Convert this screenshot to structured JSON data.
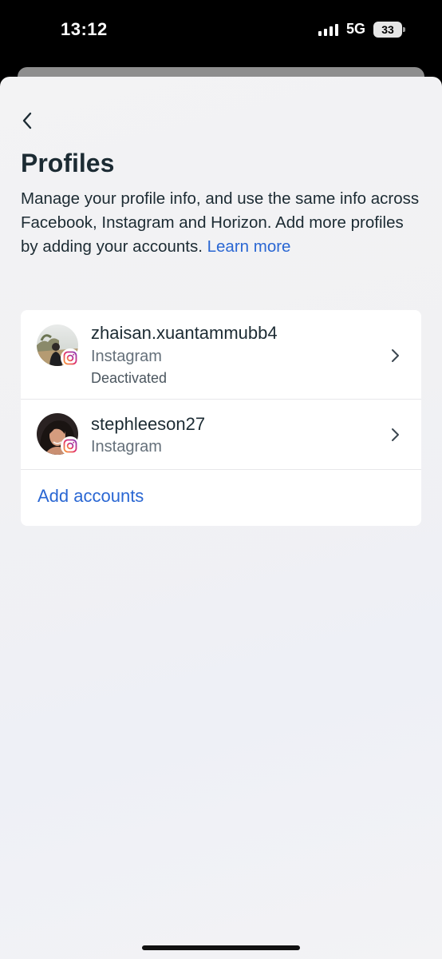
{
  "status_bar": {
    "time": "13:12",
    "network": "5G",
    "battery": "33",
    "signal_bars": 4
  },
  "header": {
    "back_icon": "chevron-left-icon",
    "title": "Profiles"
  },
  "description": {
    "text": "Manage your profile info, and use the same info across Facebook, Instagram and Horizon. Add more profiles by adding your accounts. ",
    "link": "Learn more"
  },
  "profiles": [
    {
      "username": "zhaisan.xuantammubb4",
      "platform": "Instagram",
      "status": "Deactivated",
      "badge_icon": "instagram-icon",
      "chevron_icon": "chevron-right-icon"
    },
    {
      "username": "stephleeson27",
      "platform": "Instagram",
      "badge_icon": "instagram-icon",
      "chevron_icon": "chevron-right-icon"
    }
  ],
  "actions": {
    "add_accounts": "Add accounts"
  },
  "colors": {
    "link": "#2a67d3",
    "text_primary": "#1c2b33",
    "text_secondary": "#65707a"
  }
}
